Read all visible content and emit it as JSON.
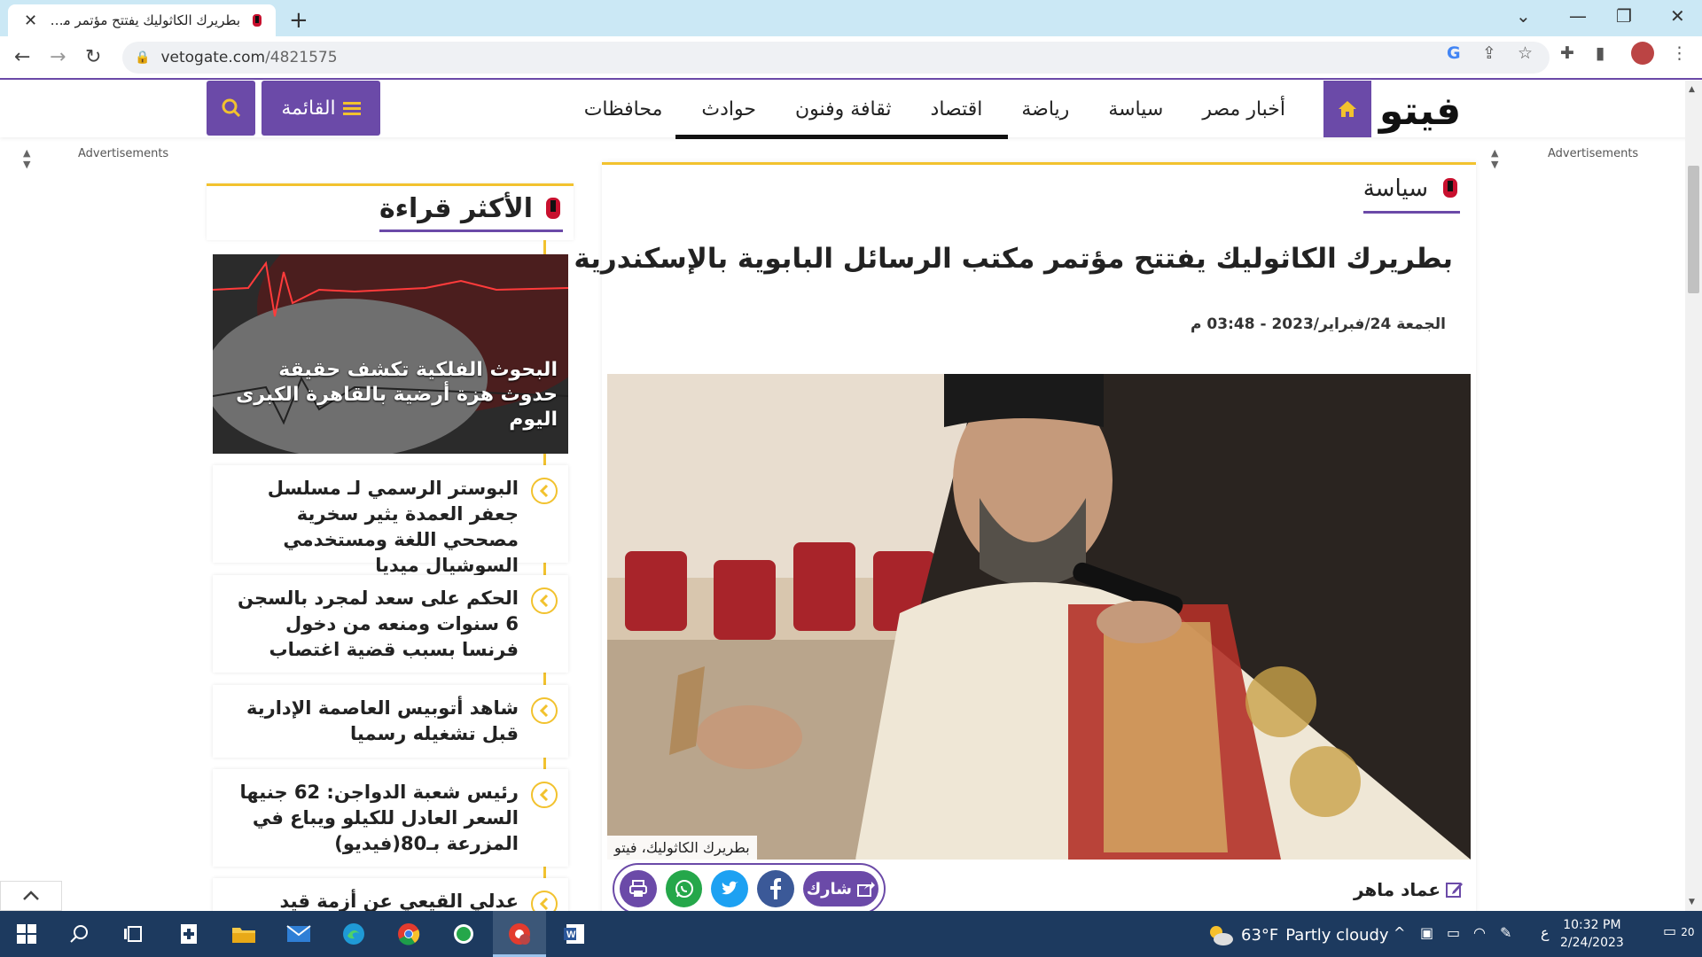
{
  "browser": {
    "tab_title": "بطريرك الكاثوليك يفتتح مؤتمر مكتب",
    "url_domain": "vetogate.com",
    "url_path": "/4821575"
  },
  "site": {
    "logo": "فيتو",
    "menu": [
      "أخبار مصر",
      "سياسة",
      "رياضة",
      "اقتصاد",
      "ثقافة وفنون",
      "حوادث",
      "محافظات"
    ],
    "menu_button": "القائمة",
    "ads_label": "Advertisements"
  },
  "article": {
    "category": "سياسة",
    "headline": "بطريرك الكاثوليك يفتتح مؤتمر مكتب الرسائل البابوية بالإسكندرية",
    "date": "الجمعة 24/فبراير/2023 - 03:48 م",
    "caption": "بطريرك الكاثوليك، فيتو",
    "author": "عماد ماهر",
    "share_label": "شارك"
  },
  "sidebar": {
    "title": "الأكثر قراءة",
    "featured": "البحوث الفلكية تكشف حقيقة حدوث هزة أرضية بالقاهرة الكبرى اليوم",
    "items": [
      "البوستر الرسمي لـ مسلسل جعفر العمدة يثير سخرية مصححي اللغة ومستخدمي السوشيال ميديا",
      "الحكم على سعد لمجرد بالسجن 6 سنوات ومنعه من دخول فرنسا بسبب قضية اغتصاب",
      "شاهد أتوبيس العاصمة الإدارية قبل تشغيله رسميا",
      "رئيس شعبة الدواجن: 62 جنيها السعر العادل للكيلو ويباع في المزرعة بـ80(فيديو)",
      "عدلي القيعي عن أزمة قيد لاعبي"
    ]
  },
  "taskbar": {
    "weather_temp": "63°F",
    "weather_text": "Partly cloudy",
    "lang": "ع",
    "time": "10:32 PM",
    "date": "2/24/2023",
    "notifications": "20"
  },
  "colors": {
    "accent": "#6b4aa8",
    "gold": "#f2c22e",
    "brand_red": "#c8102e"
  }
}
